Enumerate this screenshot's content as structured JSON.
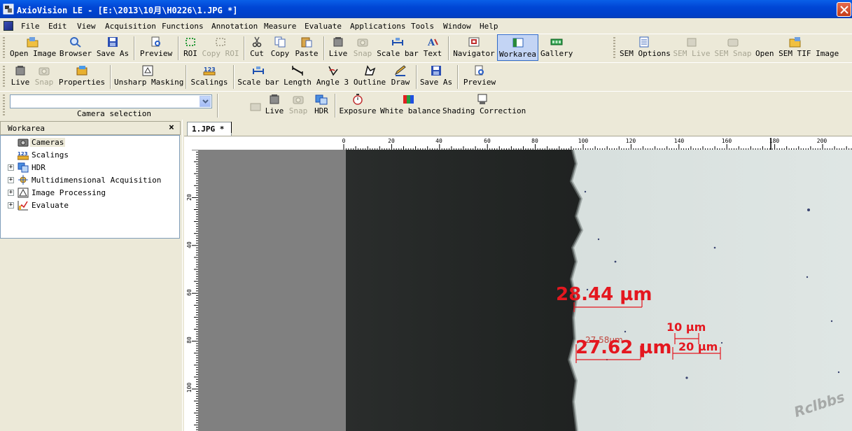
{
  "window": {
    "title": "AxioVision LE - [E:\\2013\\10月\\H0226\\1.JPG *]"
  },
  "menu": [
    "File",
    "Edit",
    "View",
    "Acquisition",
    "Functions",
    "Annotation",
    "Measure",
    "Evaluate",
    "Applications",
    "Tools",
    "Window",
    "Help"
  ],
  "toolbar1": {
    "open_image": "Open Image",
    "browser": "Browser",
    "save_as": "Save As",
    "preview": "Preview",
    "roi": "ROI",
    "copy_roi": "Copy ROI",
    "cut": "Cut",
    "copy": "Copy",
    "paste": "Paste",
    "live": "Live",
    "snap": "Snap",
    "scale_bar": "Scale bar",
    "text": "Text",
    "navigator": "Navigator",
    "workarea": "Workarea",
    "gallery": "Gallery",
    "sem_options": "SEM Options",
    "sem_live": "SEM Live",
    "sem_snap": "SEM Snap",
    "open_sem_tif": "Open SEM TIF Image"
  },
  "toolbar2": {
    "live": "Live",
    "snap": "Snap",
    "properties": "Properties",
    "unsharp_masking": "Unsharp Masking",
    "scalings": "Scalings",
    "scale_bar": "Scale bar",
    "length": "Length",
    "angle3": "Angle 3",
    "outline": "Outline",
    "draw": "Draw",
    "save_as": "Save As",
    "preview": "Preview"
  },
  "toolbar3": {
    "camera_selection_label": "Camera selection",
    "camera_selection_value": "",
    "live": "Live",
    "snap": "Snap",
    "hdr": "HDR",
    "exposure": "Exposure",
    "white_balance": "White balance",
    "shading_correction": "Shading Correction"
  },
  "workarea": {
    "title": "Workarea",
    "close": "×",
    "items": [
      {
        "label": "Cameras",
        "expandable": false,
        "icon": "camera-icon"
      },
      {
        "label": "Scalings",
        "expandable": false,
        "icon": "scalings-icon"
      },
      {
        "label": "HDR",
        "expandable": true,
        "icon": "hdr-icon"
      },
      {
        "label": "Multidimensional Acquisition",
        "expandable": true,
        "icon": "multidim-icon"
      },
      {
        "label": "Image Processing",
        "expandable": true,
        "icon": "image-processing-icon"
      },
      {
        "label": "Evaluate",
        "expandable": true,
        "icon": "evaluate-icon"
      }
    ]
  },
  "document": {
    "tab_label": "1.JPG *",
    "ruler_top": [
      "0",
      "20",
      "40",
      "60",
      "80",
      "100",
      "120",
      "140",
      "160",
      "180",
      "200"
    ],
    "ruler_left": [
      "20",
      "40",
      "60",
      "80",
      "100"
    ],
    "measurements": {
      "m1": "28.44 µm",
      "m2": "27.62 µm",
      "m2_ghost": "27.58µm",
      "m3": "10 µm",
      "m4": "20 µm"
    },
    "watermark": "Rclbbs"
  },
  "colors": {
    "titlebar": "#0046d5",
    "chrome": "#ece9d8",
    "measure_red": "#e4171f"
  }
}
